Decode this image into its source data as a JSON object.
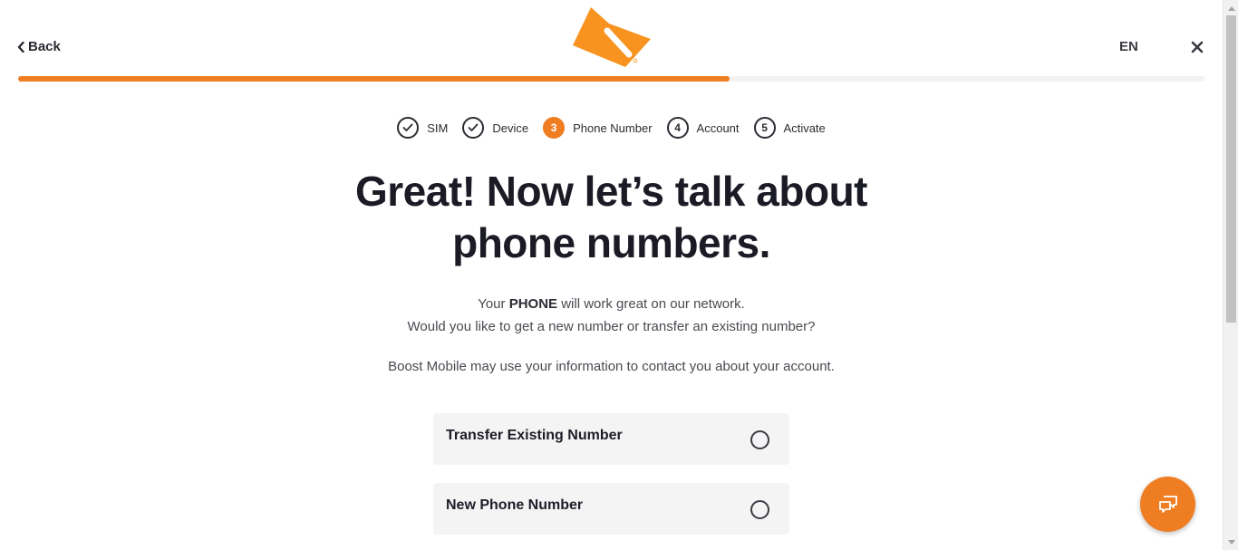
{
  "header": {
    "back_label": "Back",
    "language": "EN"
  },
  "progress": {
    "fraction": 0.6,
    "color": "#ef7d22"
  },
  "steps": [
    {
      "label": "SIM",
      "state": "done",
      "number": ""
    },
    {
      "label": "Device",
      "state": "done",
      "number": ""
    },
    {
      "label": "Phone Number",
      "state": "active",
      "number": "3"
    },
    {
      "label": "Account",
      "state": "upcoming",
      "number": "4"
    },
    {
      "label": "Activate",
      "state": "upcoming",
      "number": "5"
    }
  ],
  "heading": {
    "line1": "Great! Now let’s talk about",
    "line2": "phone numbers."
  },
  "info": {
    "line1_prefix": "Your ",
    "line1_bold": "PHONE",
    "line1_suffix": " will work great on our network.",
    "line2": "Would you like to get a new number or transfer an existing number?",
    "notice": "Boost Mobile may use your information to contact you about your account."
  },
  "options": [
    {
      "label": "Transfer Existing Number",
      "selected": false
    },
    {
      "label": "New Phone Number",
      "selected": false
    }
  ],
  "colors": {
    "accent": "#ef7d22",
    "text": "#1d1d28"
  },
  "icons": {
    "back": "chevron-left-icon",
    "close": "close-icon",
    "check": "checkmark-icon",
    "chat": "chat-bubbles-icon",
    "logo": "boost-logo"
  }
}
